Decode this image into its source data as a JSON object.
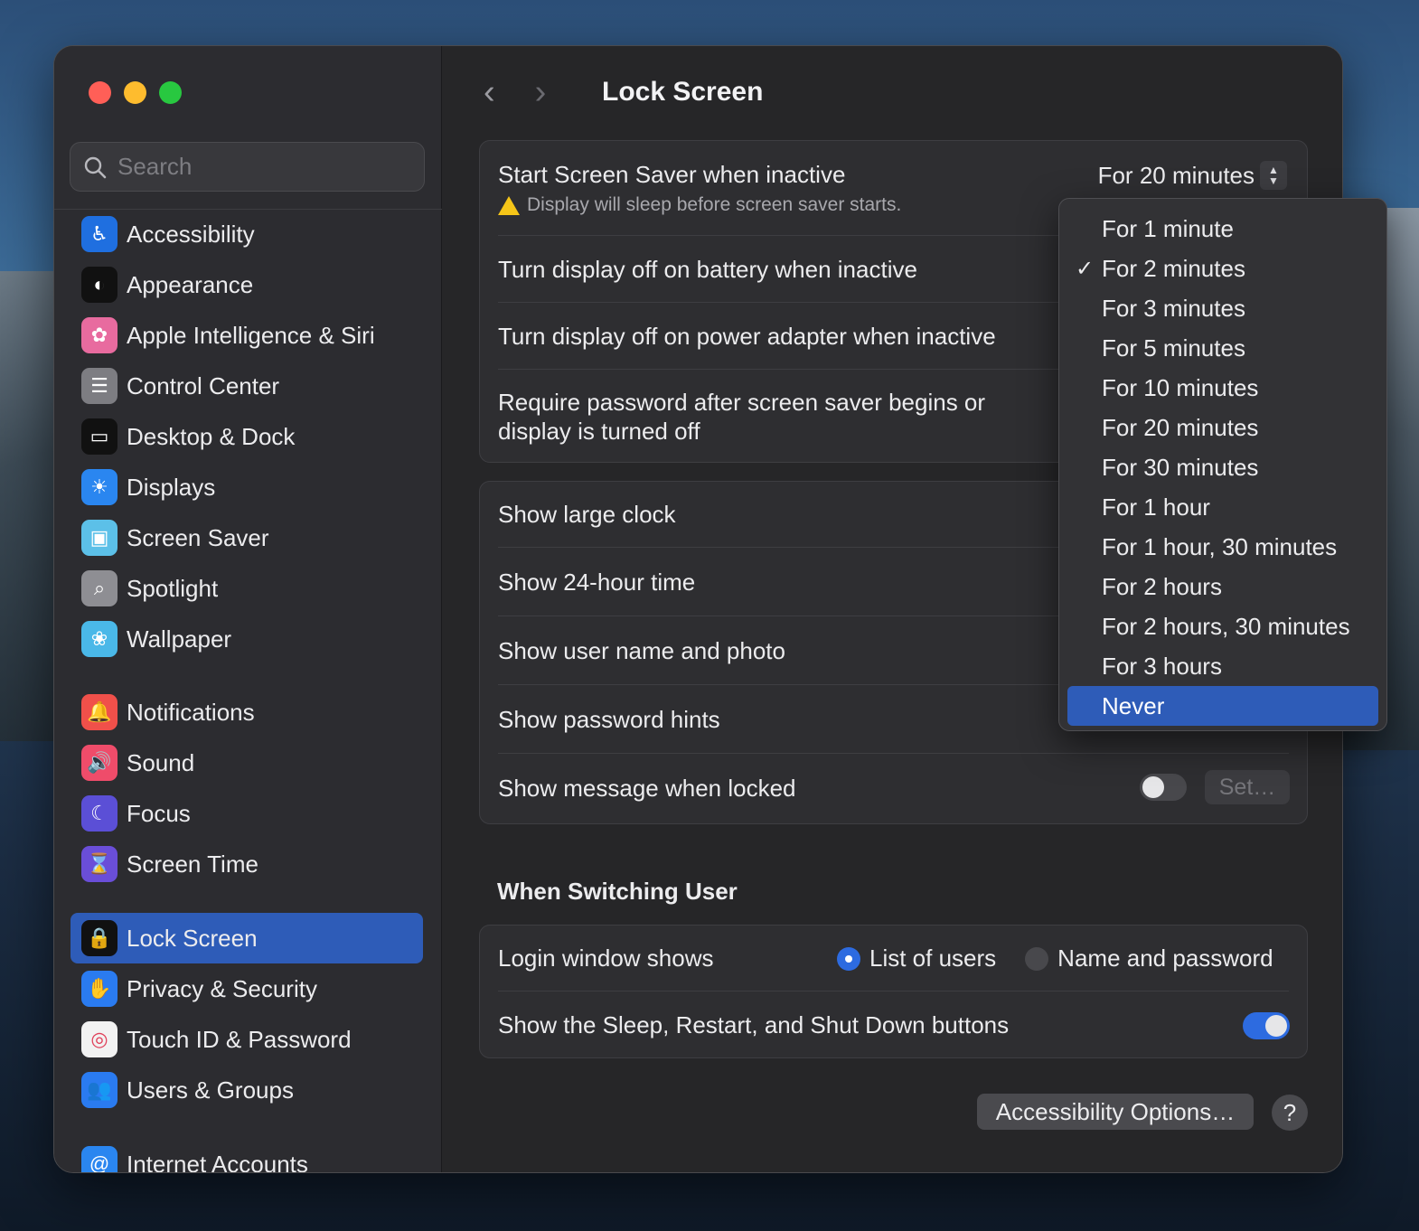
{
  "sidebar": {
    "search_placeholder": "Search",
    "items": [
      {
        "label": "Accessibility",
        "icon": "accessibility-icon",
        "color": "#1f6fe0",
        "glyph": "♿"
      },
      {
        "label": "Appearance",
        "icon": "appearance-icon",
        "color": "#111111",
        "glyph": "◐"
      },
      {
        "label": "Apple Intelligence & Siri",
        "icon": "siri-icon",
        "color": "#e86b9f",
        "glyph": "✿"
      },
      {
        "label": "Control Center",
        "icon": "control-center-icon",
        "color": "#7d7d82",
        "glyph": "☰"
      },
      {
        "label": "Desktop & Dock",
        "icon": "desktop-dock-icon",
        "color": "#111111",
        "glyph": "▭"
      },
      {
        "label": "Displays",
        "icon": "displays-icon",
        "color": "#2a86f0",
        "glyph": "☀"
      },
      {
        "label": "Screen Saver",
        "icon": "screen-saver-icon",
        "color": "#5cc0e8",
        "glyph": "▣"
      },
      {
        "label": "Spotlight",
        "icon": "spotlight-icon",
        "color": "#8e8e93",
        "glyph": "⌕"
      },
      {
        "label": "Wallpaper",
        "icon": "wallpaper-icon",
        "color": "#4ab8e8",
        "glyph": "❀"
      },
      {
        "label": "Notifications",
        "icon": "notifications-icon",
        "color": "#f0504a",
        "glyph": "🔔"
      },
      {
        "label": "Sound",
        "icon": "sound-icon",
        "color": "#ef4c6a",
        "glyph": "🔊"
      },
      {
        "label": "Focus",
        "icon": "focus-icon",
        "color": "#5b4fd6",
        "glyph": "☾"
      },
      {
        "label": "Screen Time",
        "icon": "screen-time-icon",
        "color": "#6a4ed8",
        "glyph": "⌛"
      },
      {
        "label": "Lock Screen",
        "icon": "lock-screen-icon",
        "color": "#111111",
        "glyph": "🔒",
        "selected": true
      },
      {
        "label": "Privacy & Security",
        "icon": "privacy-hand-icon",
        "color": "#2a7bf0",
        "glyph": "✋"
      },
      {
        "label": "Touch ID & Password",
        "icon": "fingerprint-icon",
        "color": "#f2f2f2",
        "glyph": "◎"
      },
      {
        "label": "Users & Groups",
        "icon": "users-icon",
        "color": "#2a7bf0",
        "glyph": "👥"
      },
      {
        "label": "Internet Accounts",
        "icon": "at-sign-icon",
        "color": "#2a86f0",
        "glyph": "@"
      }
    ]
  },
  "header": {
    "title": "Lock Screen",
    "back_icon": "chevron-left-icon",
    "forward_icon": "chevron-right-icon"
  },
  "group1": {
    "screen_saver_label": "Start Screen Saver when inactive",
    "screen_saver_value": "For 20 minutes",
    "warning_text": "Display will sleep before screen saver starts.",
    "battery_label": "Turn display off on battery when inactive",
    "adapter_label": "Turn display off on power adapter when inactive",
    "password_label_line1": "Require password after screen saver begins or",
    "password_label_line2": "display is turned off"
  },
  "group2": {
    "large_clock": "Show large clock",
    "hour24": "Show 24-hour time",
    "user_name": "Show user name and photo",
    "hints": "Show password hints",
    "message": "Show message when locked",
    "message_toggle": false,
    "set_button": "Set…"
  },
  "switching": {
    "title": "When Switching User",
    "login_label": "Login window shows",
    "option_list": "List of users",
    "option_name": "Name and password",
    "selected": "List of users",
    "buttons_label": "Show the Sleep, Restart, and Shut Down buttons",
    "buttons_toggle": true
  },
  "footer": {
    "accessibility_button": "Accessibility Options…",
    "help_button": "?"
  },
  "dropdown": {
    "items": [
      {
        "label": "For 1 minute"
      },
      {
        "label": "For 2 minutes",
        "checked": true
      },
      {
        "label": "For 3 minutes"
      },
      {
        "label": "For 5 minutes"
      },
      {
        "label": "For 10 minutes"
      },
      {
        "label": "For 20 minutes"
      },
      {
        "label": "For 30 minutes"
      },
      {
        "label": "For 1 hour"
      },
      {
        "label": "For 1 hour, 30 minutes"
      },
      {
        "label": "For 2 hours"
      },
      {
        "label": "For 2 hours, 30 minutes"
      },
      {
        "label": "For 3 hours"
      },
      {
        "label": "Never",
        "highlighted": true
      }
    ],
    "check_glyph": "✓"
  },
  "colors": {
    "accent": "#2d6be0",
    "selection": "#2e5cb8",
    "warning": "#f5c518"
  }
}
